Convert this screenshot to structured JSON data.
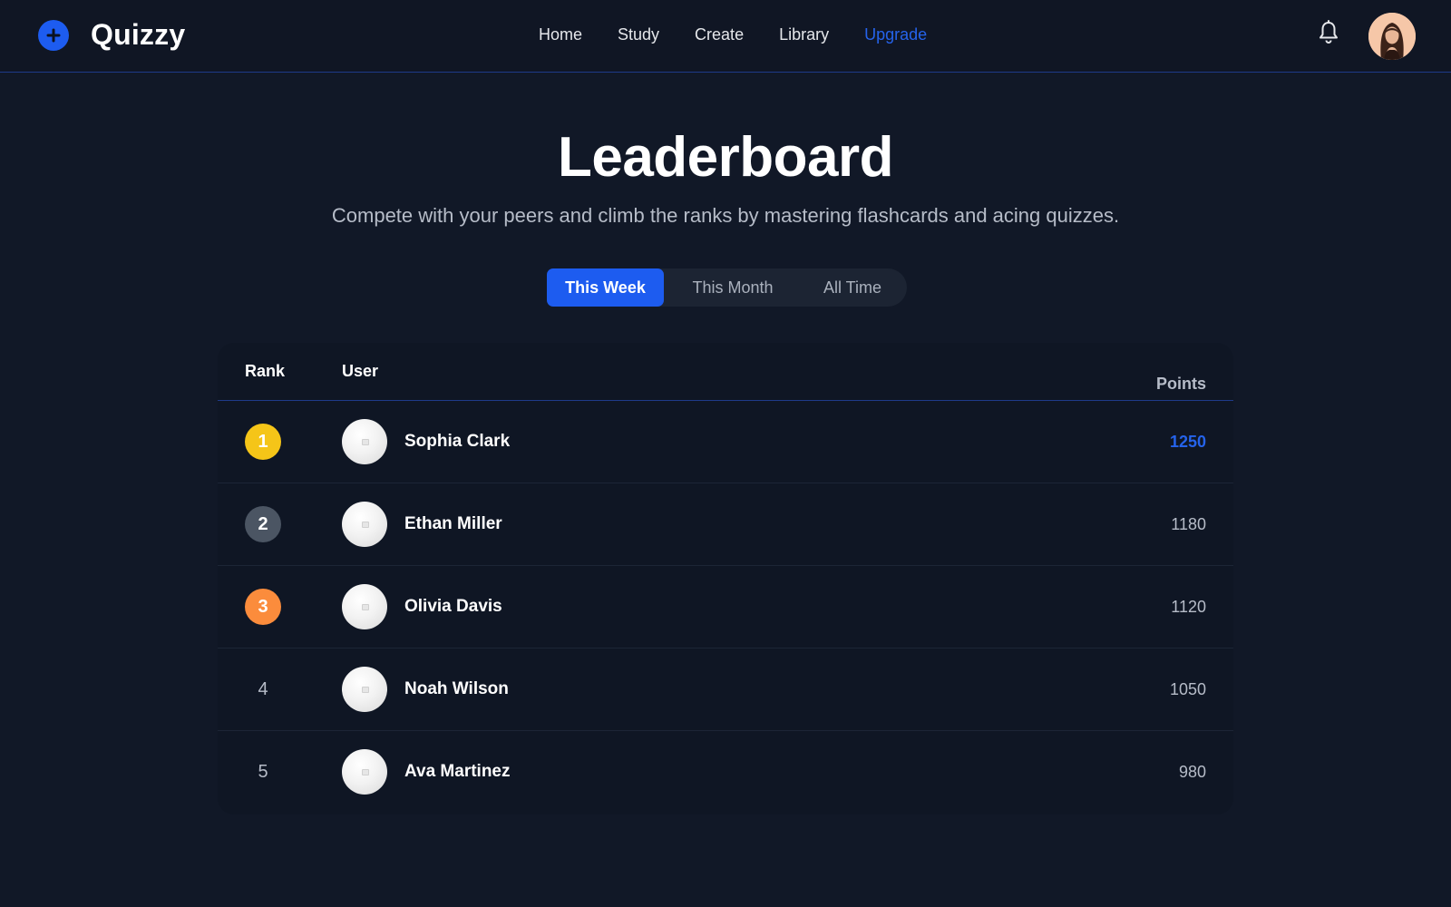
{
  "app": {
    "name": "Quizzy",
    "logo_icon": "plus-icon",
    "accent_color": "#1d5cf0"
  },
  "nav": {
    "items": [
      {
        "label": "Home"
      },
      {
        "label": "Study"
      },
      {
        "label": "Create"
      },
      {
        "label": "Library"
      },
      {
        "label": "Upgrade"
      }
    ],
    "notification_icon": "bell-icon",
    "profile_icon": "user-avatar-icon"
  },
  "hero": {
    "title": "Leaderboard",
    "subtitle": "Compete with your peers and climb the ranks by mastering flashcards and acing quizzes."
  },
  "tabs": [
    {
      "label": "This Week",
      "active": true
    },
    {
      "label": "This Month",
      "active": false
    },
    {
      "label": "All Time",
      "active": false
    }
  ],
  "table": {
    "headers": {
      "rank": "Rank",
      "user": "User",
      "points": "Points"
    },
    "rows": [
      {
        "rank": "1",
        "name": "Sophia Clark",
        "points": "1250",
        "badge_color": "#f5c518"
      },
      {
        "rank": "2",
        "name": "Ethan Miller",
        "points": "1180",
        "badge_color": "#4b5563"
      },
      {
        "rank": "3",
        "name": "Olivia Davis",
        "points": "1120",
        "badge_color": "#fb8c3c"
      },
      {
        "rank": "4",
        "name": "Noah Wilson",
        "points": "1050"
      },
      {
        "rank": "5",
        "name": "Ava Martinez",
        "points": "980"
      }
    ]
  }
}
